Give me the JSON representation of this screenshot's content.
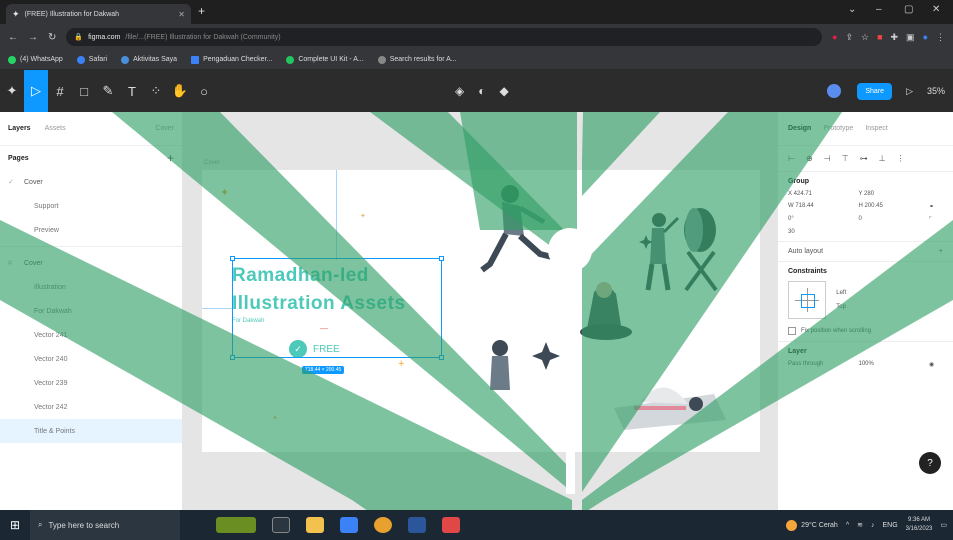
{
  "browser": {
    "tab_title": "(FREE) Illustration for Dakwah",
    "bookmarks": [
      {
        "label": "(4) WhatsApp",
        "color": "#25d366"
      },
      {
        "label": "Safari",
        "color": "#3b82f6"
      },
      {
        "label": "Aktivitas Saya",
        "color": "#4a90d9"
      },
      {
        "label": "Pengaduan Checker...",
        "color": "#3b82f6"
      },
      {
        "label": "Complete UI Kit - A...",
        "color": "#22c55e"
      },
      {
        "label": "Search results for A...",
        "color": "#888888"
      }
    ],
    "url_host": "figma.com",
    "url_path": "/file/...(FREE) Illustration for Dakwah (Community)"
  },
  "figma": {
    "share_label": "Share",
    "zoom": "35%"
  },
  "left_panel": {
    "tabs": [
      "Layers",
      "Assets"
    ],
    "page_selector": "Cover",
    "pages_label": "Pages",
    "pages": [
      "Cover",
      "Support",
      "Preview"
    ],
    "frame_name": "Cover",
    "layers": [
      "Illustration",
      "For Dakwah",
      "Vector 241",
      "Vector 240",
      "Vector 239",
      "Vector 242",
      "Title & Points"
    ]
  },
  "canvas": {
    "frame_label": "Cover",
    "headline_1": "Ramadhan-Ied",
    "headline_2": "Illustration Assets",
    "subhead": "For Dakwah",
    "free_label": "FREE",
    "size_badge": "718.44 × 200.45"
  },
  "right_panel": {
    "tabs": [
      "Design",
      "Prototype",
      "Inspect"
    ],
    "group_title": "Group",
    "x": "X  424.71",
    "y": "Y  280",
    "w": "W  718.44",
    "h": "H  200.45",
    "rotation": "0°",
    "radius": "0",
    "clip": "30",
    "auto_layout": "Auto layout",
    "constraints_title": "Constraints",
    "constraint_h": "Left",
    "constraint_v": "Top",
    "fix_position": "Fix position when scrolling",
    "layer_title": "Layer",
    "blend": "Pass through",
    "opacity": "100%"
  },
  "taskbar": {
    "search_placeholder": "Type here to search",
    "weather": "29°C Cerah",
    "lang": "ENG",
    "time": "9:36 AM",
    "date": "3/16/2023"
  },
  "colors": {
    "accent": "#0d99ff",
    "teal": "#4cc9b9",
    "watermark": "#2f9e64"
  }
}
